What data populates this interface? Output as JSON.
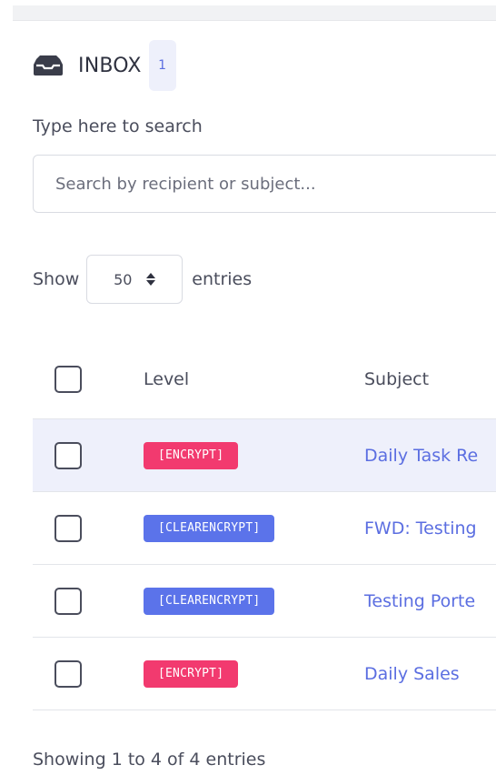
{
  "inbox": {
    "title": "INBOX",
    "count": "1",
    "icon": "inbox-icon"
  },
  "search": {
    "label": "Type here to search",
    "placeholder": "Search by recipient or subject..."
  },
  "entries": {
    "show_label": "Show",
    "value": "50",
    "suffix": "entries"
  },
  "table": {
    "columns": [
      "Level",
      "Subject"
    ],
    "rows": [
      {
        "level": "[ENCRYPT]",
        "level_type": "encrypt",
        "subject": "Daily Task Re",
        "highlighted": true
      },
      {
        "level": "[CLEARENCRYPT]",
        "level_type": "clearencrypt",
        "subject": "FWD: Testing",
        "highlighted": false
      },
      {
        "level": "[CLEARENCRYPT]",
        "level_type": "clearencrypt",
        "subject": "Testing Porte",
        "highlighted": false
      },
      {
        "level": "[ENCRYPT]",
        "level_type": "encrypt",
        "subject": "Daily Sales",
        "highlighted": false
      }
    ]
  },
  "footer": {
    "info": "Showing 1 to 4 of 4 entries"
  },
  "colors": {
    "encrypt_badge": "#f23a6f",
    "clearencrypt_badge": "#5b73ea",
    "link": "#5b6ee1",
    "row_highlight": "#eef0fb"
  }
}
